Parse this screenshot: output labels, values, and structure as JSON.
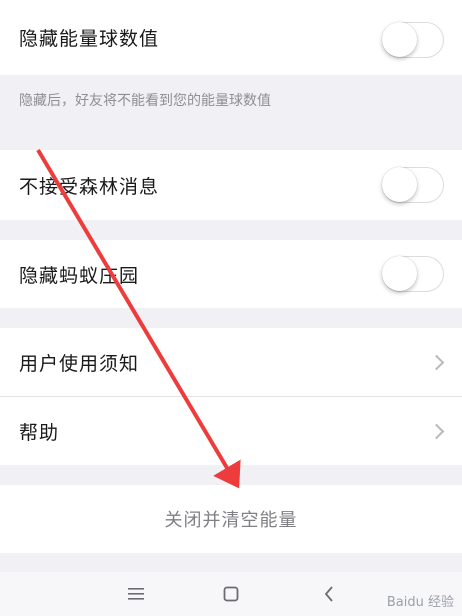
{
  "settings": {
    "hide_energy": {
      "label": "隐藏能量球数值",
      "enabled": false
    },
    "hide_energy_hint": "隐藏后，好友将不能看到您的能量球数值",
    "no_forest_msgs": {
      "label": "不接受森林消息",
      "enabled": false
    },
    "hide_ant_manor": {
      "label": "隐藏蚂蚁庄园",
      "enabled": false
    },
    "user_notice": {
      "label": "用户使用须知"
    },
    "help": {
      "label": "帮助"
    },
    "close_clear": {
      "label": "关闭并清空能量"
    }
  },
  "navbar": {
    "menu_icon": "menu-icon",
    "home_icon": "home-square-icon",
    "back_icon": "back-chevron-icon"
  },
  "watermark": {
    "text": "Baidu 经验"
  },
  "colors": {
    "annotation_arrow": "#ee3b3b"
  }
}
